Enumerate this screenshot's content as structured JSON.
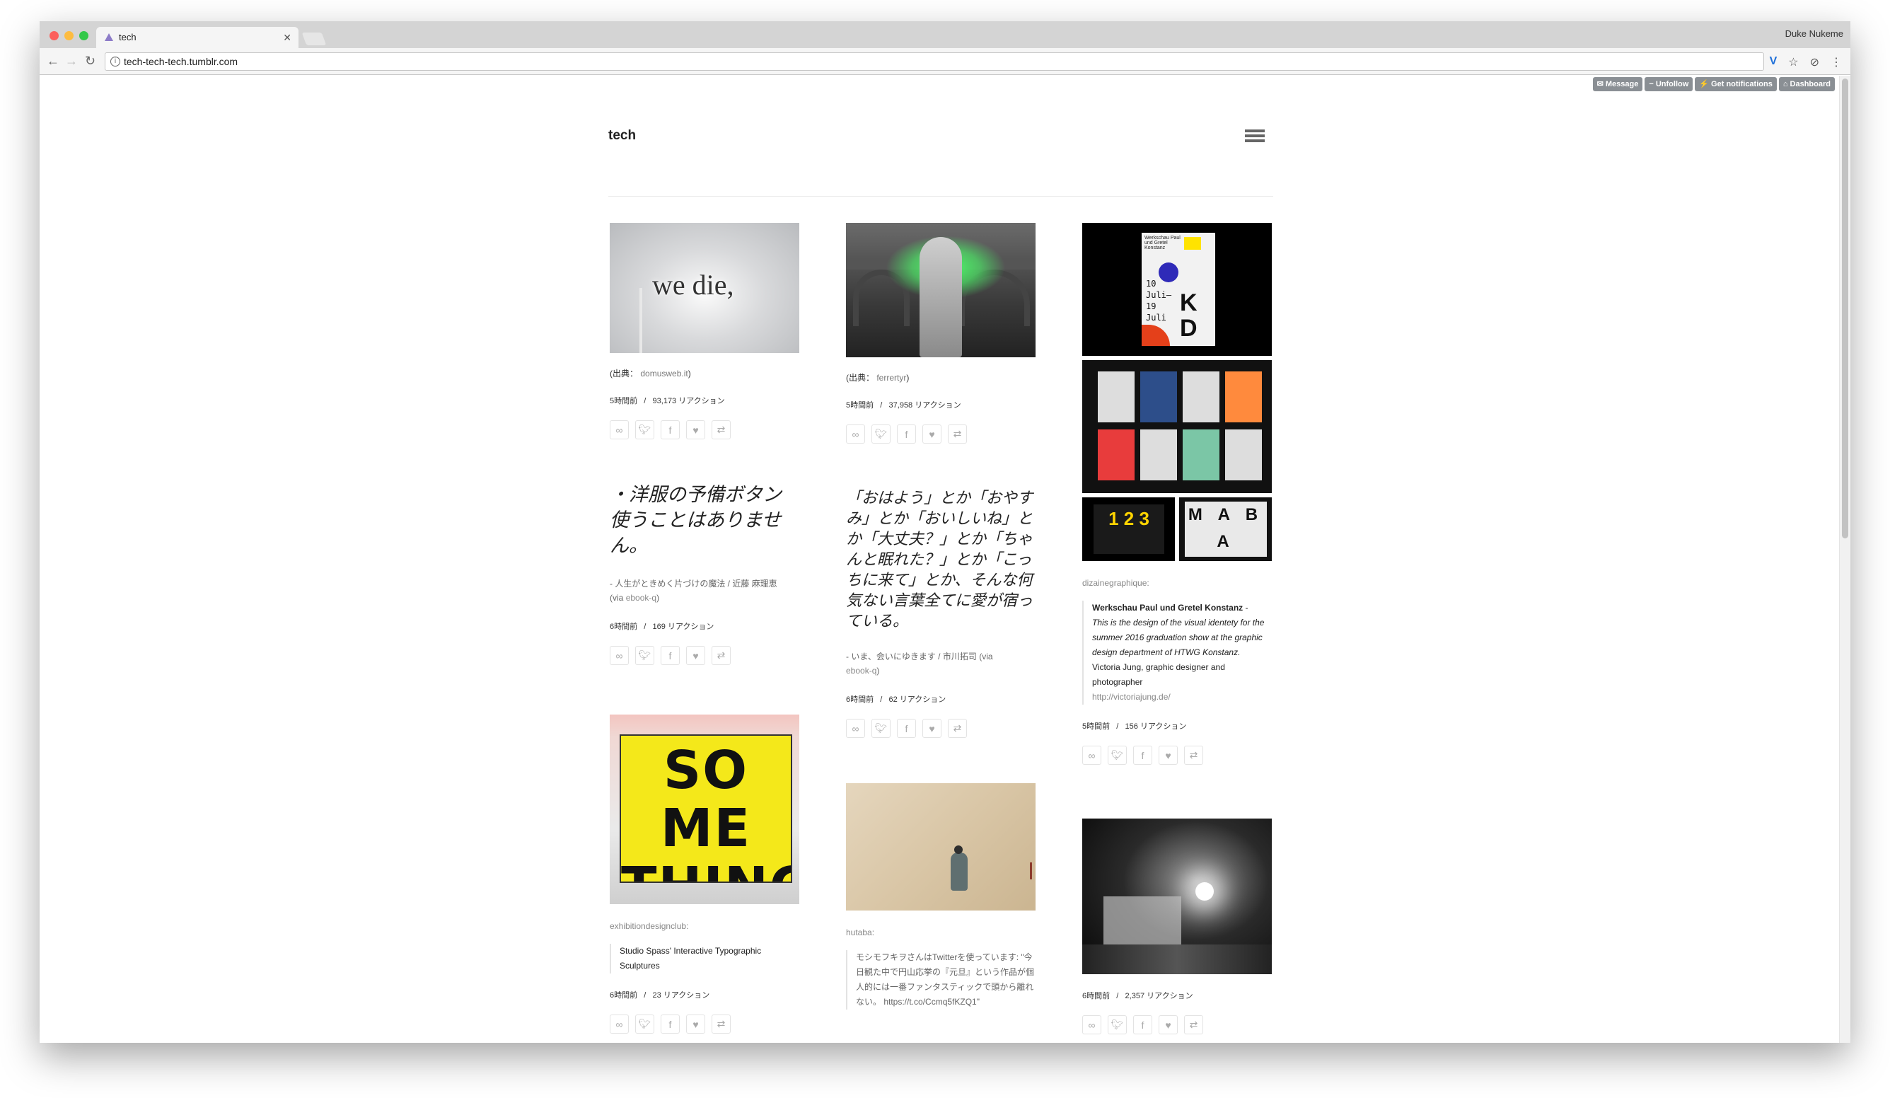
{
  "browser": {
    "tab_title": "tech",
    "user": "Duke Nukeme",
    "url": "tech-tech-tech.tumblr.com"
  },
  "tumblr_bar": {
    "message": "Message",
    "unfollow": "Unfollow",
    "notifications": "Get notifications",
    "dashboard": "Dashboard"
  },
  "blog": {
    "title": "tech"
  },
  "posts": {
    "p1": {
      "src_label": "(出典：",
      "src_link": "domusweb.it",
      "src_end": ")",
      "time": "5時間前",
      "sep": "/",
      "reactions": "93,173 リアクション",
      "image_text": "we die,"
    },
    "p2": {
      "quote": "・洋服の予備ボタン　使うことはありません。",
      "source": "- 人生がときめく片づけの魔法 / 近藤 麻理恵",
      "via": "(via",
      "via_link": "ebook-q",
      "via_end": ")",
      "time": "6時間前",
      "sep": "/",
      "reactions": "169 リアクション"
    },
    "p3": {
      "user": "exhibitiondesignclub",
      "colon": ":",
      "body": "Studio Spass' Interactive Typographic Sculptures",
      "time": "6時間前",
      "sep": "/",
      "reactions": "23 リアクション",
      "image_text_1": "SO ME",
      "image_text_2": "THING"
    },
    "p4": {
      "src_label": "(出典：",
      "src_link": "ferrertyr",
      "src_end": ")",
      "time": "5時間前",
      "sep": "/",
      "reactions": "37,958 リアクション"
    },
    "p5": {
      "quote": "「おはよう」とか「おやすみ」とか「おいしいね」とか「大丈夫？」とか「ちゃんと眠れた？」とか「こっちに来て」とか、そんな何気ない言葉全てに愛が宿っている。",
      "source": "- いま、会いにゆきます / 市川拓司",
      "via": "(via",
      "via_link": "ebook-q",
      "via_end": ")",
      "time": "6時間前",
      "sep": "/",
      "reactions": "62 リアクション"
    },
    "p6": {
      "user": "hutaba",
      "colon": ":",
      "body": "モシモフキヲさんはTwitterを使っています: \"今日観た中で円山応挙の『元旦』という作品が個人的には一番ファンタスティックで頭から離れない。 https://t.co/Ccmq5fKZQ1\""
    },
    "p7": {
      "user": "dizainegraphique",
      "colon": ":",
      "heading": "Werkschau Paul und Gretel Konstanz",
      "dash": " -",
      "body": "This is the design of the visual identety for the summer 2016 graduation show at the graphic design department of HTWG Konstanz.",
      "credit": "Victoria Jung, graphic designer and photographer",
      "link": "http://victoriajung.de/",
      "time": "5時間前",
      "sep": "/",
      "reactions": "156 リアクション",
      "poster_text": "10 Juli– 19 Juli",
      "poster_head": "Werkschau Paul und Gretel Konstanz",
      "letters_1": "K",
      "letters_2": "D",
      "tile_1": "1 2 3",
      "tile_2": "M A B A"
    },
    "p8": {
      "time": "6時間前",
      "sep": "/",
      "reactions": "2,357 リアクション"
    }
  },
  "icons": [
    "link-icon",
    "twitter-icon",
    "facebook-icon",
    "like-icon",
    "reblog-icon"
  ],
  "colors": {
    "accent_bar": "#8a8f94",
    "green_glow": "#4dff6a",
    "poster_yellow": "#f4e81a"
  }
}
